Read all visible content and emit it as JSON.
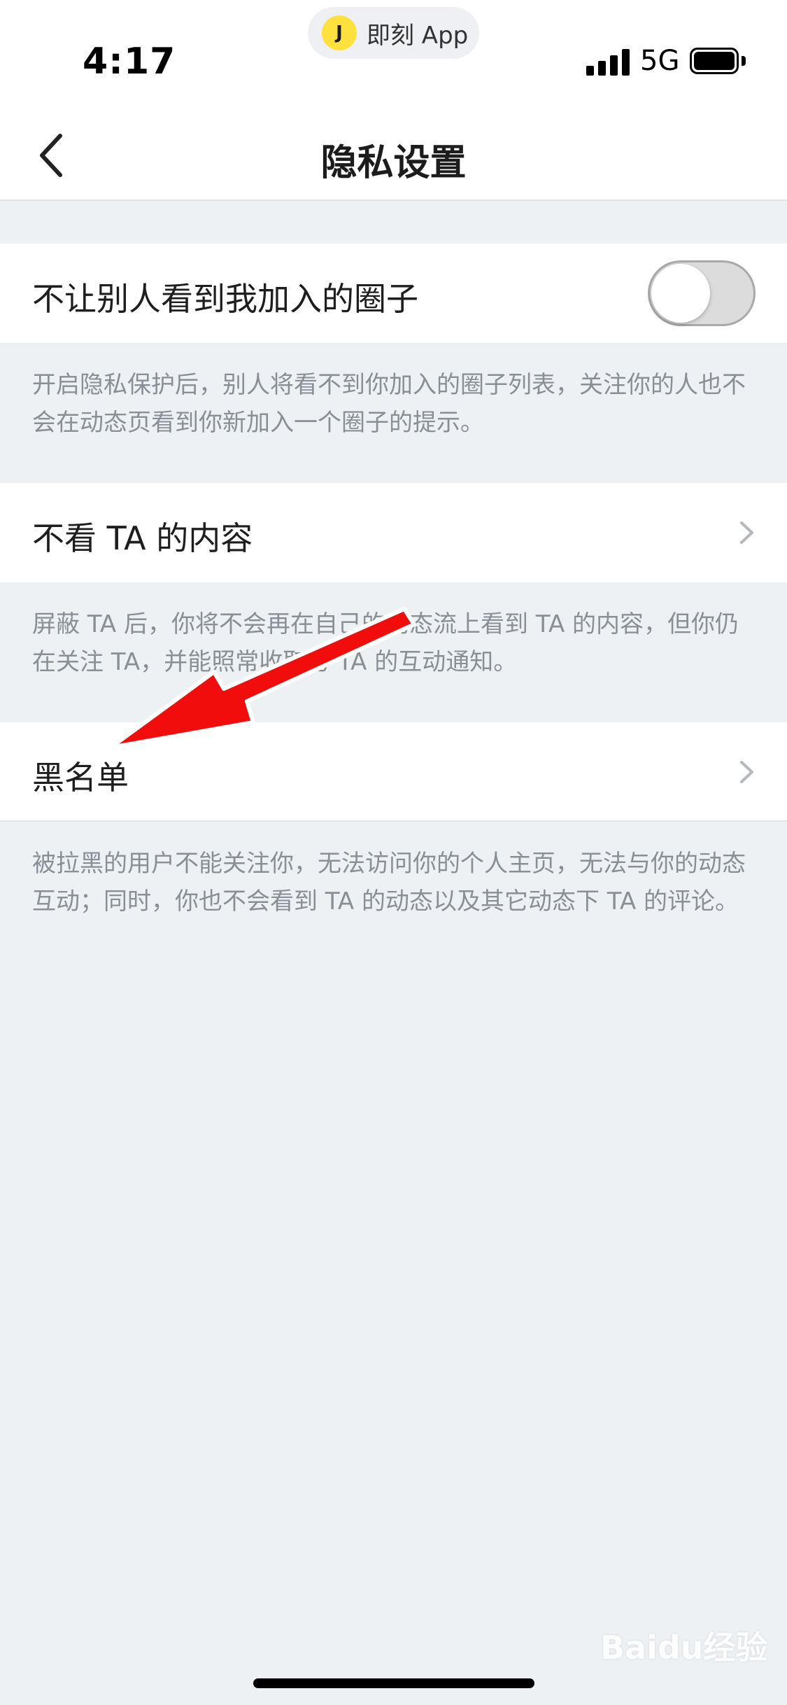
{
  "status_bar": {
    "time": "4:17",
    "app_pill_logo": "J",
    "app_pill_label": "即刻 App",
    "network": "5G"
  },
  "nav": {
    "title": "隐私设置",
    "back_icon": "chevron-left-icon"
  },
  "settings": {
    "hide_circles": {
      "label": "不让别人看到我加入的圈子",
      "enabled": false,
      "description": "开启隐私保护后，别人将看不到你加入的圈子列表，关注你的人也不会在动态页看到你新加入一个圈子的提示。"
    },
    "mute_content": {
      "label": "不看 TA 的内容",
      "description": "屏蔽 TA 后，你将不会再在自己的动态流上看到 TA 的内容，但你仍在关注 TA，并能照常收取与 TA 的互动通知。"
    },
    "blacklist": {
      "label": "黑名单",
      "description": "被拉黑的用户不能关注你，无法访问你的个人主页，无法与你的动态互动；同时，你也不会看到 TA 的动态以及其它动态下 TA 的评论。"
    }
  },
  "overlay": {
    "arrow_color": "#f20d0d"
  },
  "watermark": "Baidu经验",
  "colors": {
    "background": "#eef1f4",
    "hint_text": "#8a8f96",
    "app_logo": "#ffe13d"
  }
}
